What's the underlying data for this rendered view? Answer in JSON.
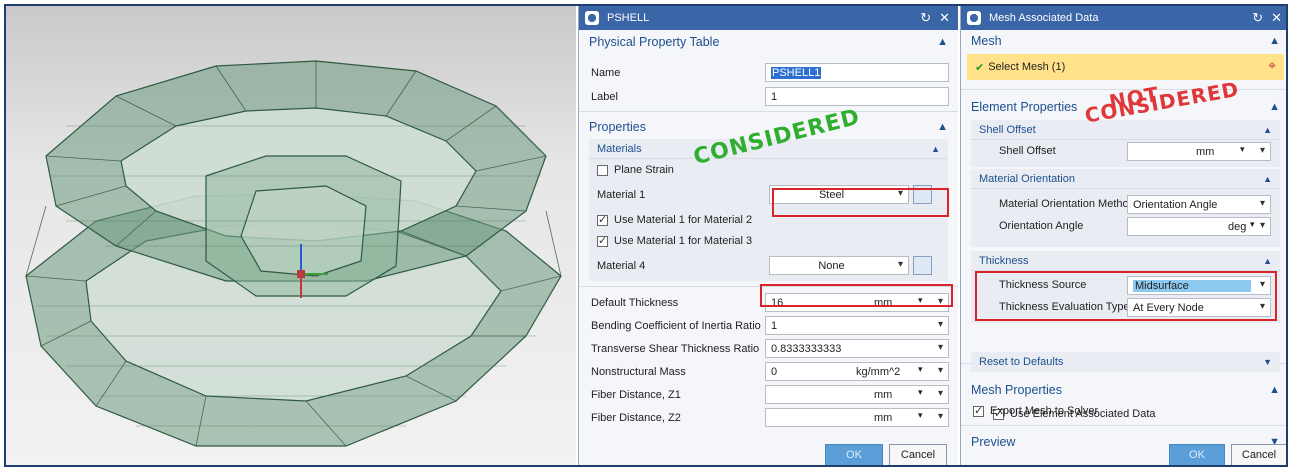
{
  "pshell": {
    "title": "PSHELL",
    "sections": {
      "physical_property_table": "Physical Property Table",
      "properties": "Properties",
      "materials": "Materials"
    },
    "name_label": "Name",
    "name_value": "PSHELL1",
    "label_label": "Label",
    "label_value": "1",
    "plane_strain": "Plane Strain",
    "material1_label": "Material 1",
    "material1_value": "Steel",
    "use_mat1_mat2": "Use Material 1 for Material 2",
    "use_mat1_mat3": "Use Material 1 for Material 3",
    "material4_label": "Material 4",
    "material4_value": "None",
    "default_thickness_label": "Default Thickness",
    "default_thickness_value": "16",
    "default_thickness_unit": "mm",
    "bending_label": "Bending Coefficient of Inertia Ratio",
    "bending_value": "1",
    "transverse_label": "Transverse Shear Thickness Ratio",
    "transverse_value": "0.8333333333",
    "nonstructural_label": "Nonstructural Mass",
    "nonstructural_value": "0",
    "nonstructural_unit": "kg/mm^2",
    "fiber_z1_label": "Fiber Distance, Z1",
    "fiber_z1_unit": "mm",
    "fiber_z2_label": "Fiber Distance, Z2",
    "fiber_z2_unit": "mm",
    "ok": "OK",
    "cancel": "Cancel",
    "stamp": "CONSIDERED"
  },
  "mesh_assoc": {
    "title": "Mesh Associated Data",
    "mesh": "Mesh",
    "select_mesh": "Select Mesh (1)",
    "element_properties": "Element Properties",
    "shell_offset_head": "Shell Offset",
    "shell_offset_label": "Shell Offset",
    "shell_offset_unit": "mm",
    "material_orientation_head": "Material Orientation",
    "mat_orient_method_label": "Material Orientation Method",
    "mat_orient_method_value": "Orientation Angle",
    "orient_angle_label": "Orientation Angle",
    "orient_angle_unit": "deg",
    "thickness_head": "Thickness",
    "thickness_source_label": "Thickness Source",
    "thickness_source_value": "Midsurface",
    "thickness_eval_label": "Thickness Evaluation Type",
    "thickness_eval_value": "At Every Node",
    "use_element_assoc": "Use Element Associated Data",
    "reset_defaults": "Reset to Defaults",
    "mesh_properties": "Mesh Properties",
    "export_mesh": "Export Mesh to Solver",
    "preview": "Preview",
    "ok": "OK",
    "cancel": "Cancel",
    "stamp_line1": "NOT",
    "stamp_line2": "CONSIDERED"
  },
  "colors": {
    "title_bar": "#3a66a8",
    "header_text": "#1e4f8f",
    "red": "#d9242a",
    "green_stamp": "#2fae2f",
    "mesh_green": "#3f6b52"
  }
}
